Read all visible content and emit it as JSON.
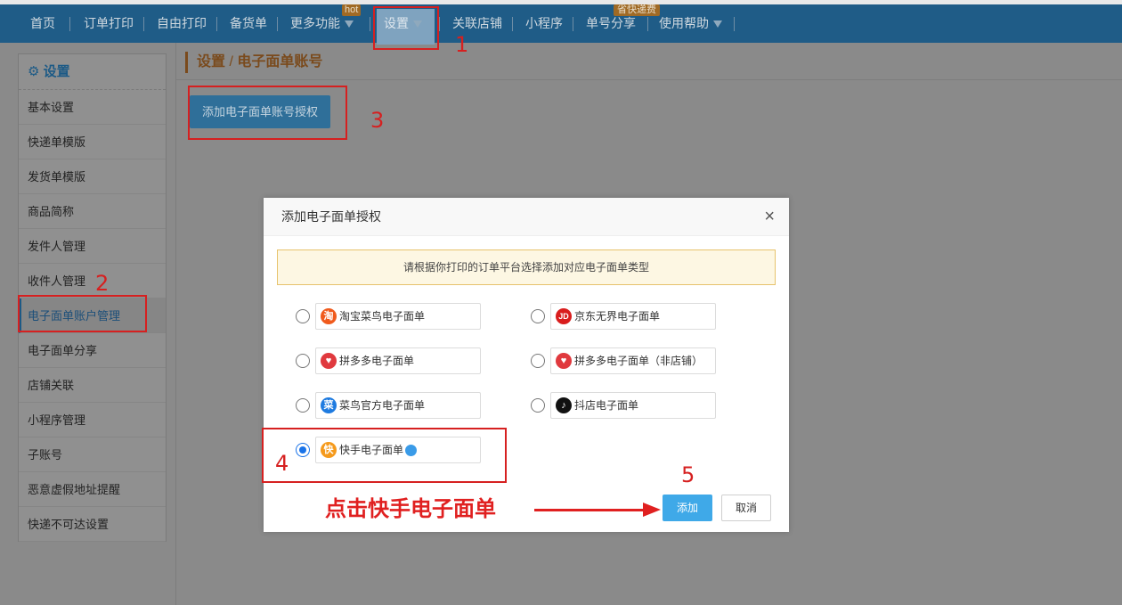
{
  "nav": {
    "items": [
      "首页",
      "订单打印",
      "自由打印",
      "备货单",
      "更多功能",
      "设置",
      "关联店铺",
      "小程序",
      "单号分享",
      "使用帮助"
    ],
    "hot_badge": "hot",
    "save_badge": "省快递费",
    "accent": "#1f5c87"
  },
  "sidebar": {
    "title": "设置",
    "items": [
      "基本设置",
      "快递单模版",
      "发货单模版",
      "商品简称",
      "发件人管理",
      "收件人管理",
      "电子面单账户管理",
      "电子面单分享",
      "店铺关联",
      "小程序管理",
      "子账号",
      "恶意虚假地址提醒",
      "快递不可达设置"
    ],
    "active_item": "电子面单账户管理"
  },
  "breadcrumb": {
    "parent": "设置",
    "separator": "/",
    "current": "电子面单账号"
  },
  "main": {
    "auth_button": "添加电子面单账号授权"
  },
  "modal": {
    "title": "添加电子面单授权",
    "close_icon": "×",
    "notice": "请根据你打印的订单平台选择添加对应电子面单类型",
    "options": [
      {
        "label": "淘宝菜鸟电子面单",
        "logo": "淘",
        "logo_color": "#f05a1c",
        "icon": "taobao-icon"
      },
      {
        "label": "京东无界电子面单",
        "logo": "JD",
        "logo_color": "#d91d1d",
        "icon": "jd-icon"
      },
      {
        "label": "拼多多电子面单",
        "logo": "♥",
        "logo_color": "#e0393e",
        "icon": "pinduoduo-icon"
      },
      {
        "label": "拼多多电子面单（非店铺）",
        "logo": "♥",
        "logo_color": "#e0393e",
        "icon": "pinduoduo-icon"
      },
      {
        "label": "菜鸟官方电子面单",
        "logo": "菜",
        "logo_color": "#1f7be0",
        "icon": "cainiao-icon"
      },
      {
        "label": "抖店电子面单",
        "logo": "♪",
        "logo_color": "#111111",
        "icon": "douyin-icon"
      },
      {
        "label": "快手电子面单",
        "logo": "快",
        "logo_color": "#f59a1c",
        "icon": "kuaishou-icon",
        "selected": true
      }
    ],
    "add_button": "添加",
    "cancel_button": "取消"
  },
  "annotations": {
    "step1": "1",
    "step2": "2",
    "step3": "3",
    "step4": "4",
    "step5": "5",
    "hint": "点击快手电子面单"
  }
}
